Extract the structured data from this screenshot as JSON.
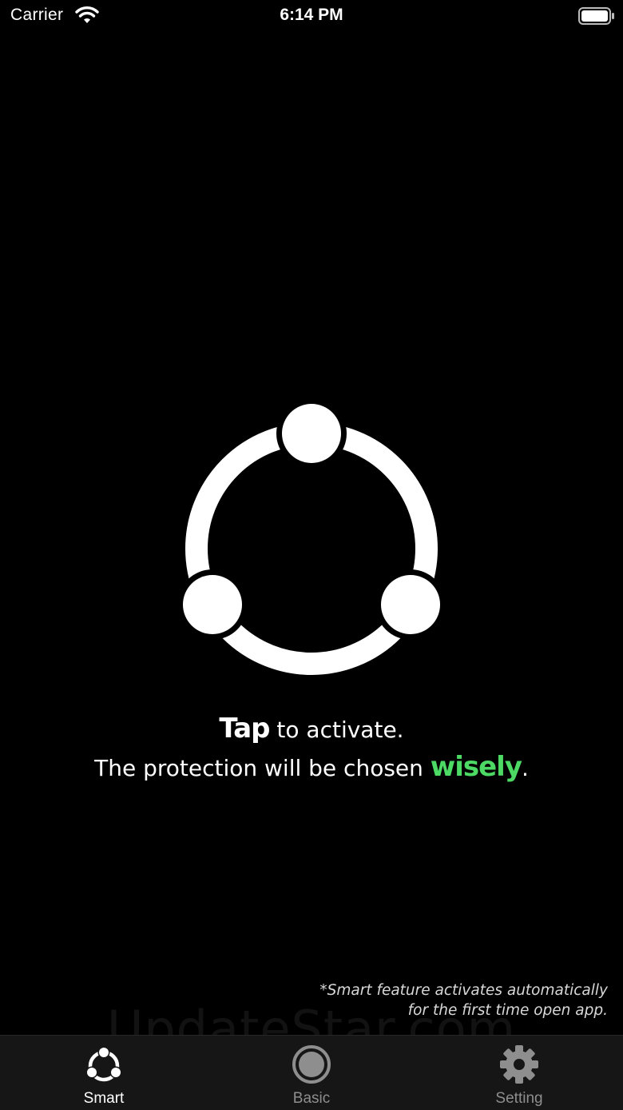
{
  "status_bar": {
    "carrier": "Carrier",
    "time": "6:14 PM",
    "icons": [
      "wifi-icon",
      "battery-icon"
    ]
  },
  "main": {
    "activate_icon": "smart-network-icon",
    "tagline": {
      "line1_strong": "Tap",
      "line1_rest": " to activate.",
      "line2_start": "The protection will be chosen ",
      "line2_highlight": "wisely",
      "line2_end": "."
    },
    "footnote": {
      "line1": "*Smart feature activates automatically",
      "line2": "for the first time open app."
    },
    "watermark": "UpdateStar.com"
  },
  "tabs": [
    {
      "label": "Smart",
      "icon": "smart-network-icon",
      "active": true
    },
    {
      "label": "Basic",
      "icon": "record-icon",
      "active": false
    },
    {
      "label": "Setting",
      "icon": "gear-icon",
      "active": false
    }
  ],
  "colors": {
    "background": "#000000",
    "highlight": "#4cd964",
    "tab_bar": "#161616",
    "tab_inactive": "#8e8e8e"
  }
}
